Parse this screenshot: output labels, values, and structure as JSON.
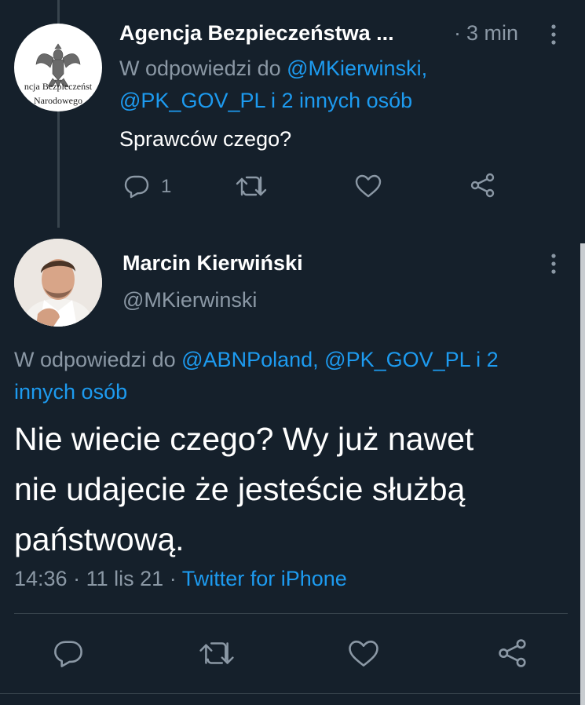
{
  "reply_tweet": {
    "author_name": "Agencja Bezpieczeństwa ...",
    "separator": "·",
    "time": "3 min",
    "reply_prefix": "W odpowiedzi do",
    "mention1": "@MKierwinski,",
    "mention2": "@PK_GOV_PL",
    "reply_rest": "i 2 innych osób",
    "text": "Sprawców czego?",
    "reply_count": "1",
    "avatar_caption_line1": "ncja Bezpieczeńst",
    "avatar_caption_line2": "Narodowego"
  },
  "main_tweet": {
    "author_name": "Marcin Kierwiński",
    "handle": "@MKierwinski",
    "reply_prefix": "W odpowiedzi do",
    "mention1": "@ABNPoland,",
    "mention2": "@PK_GOV_PL",
    "reply_rest_line1": "i 2",
    "reply_rest_line2": "innych osób",
    "text_line1": "Nie wiecie czego? Wy już nawet",
    "text_line2": "nie udajecie że jesteście służbą",
    "text_line3": "państwową.",
    "time": "14:36",
    "date": "11 lis 21",
    "dot": "·",
    "source": "Twitter for iPhone"
  },
  "icons": [
    "more-icon",
    "reply-icon",
    "retweet-icon",
    "like-icon",
    "share-icon",
    "eagle-emblem"
  ],
  "colors": {
    "background": "#15202b",
    "text": "#ffffff",
    "secondary": "#8b98a5",
    "link": "#1d9bf0",
    "border": "#38444d"
  }
}
